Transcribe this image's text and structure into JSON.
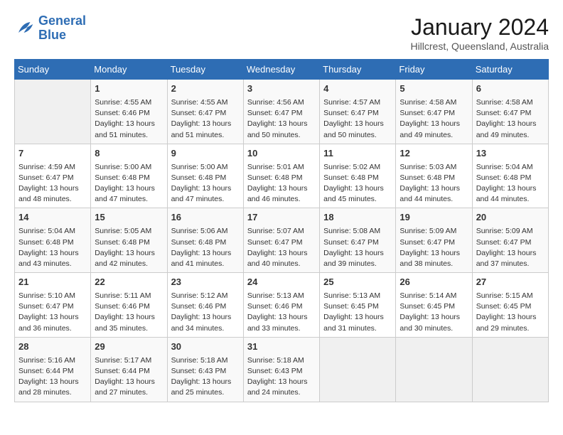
{
  "logo": {
    "line1": "General",
    "line2": "Blue"
  },
  "title": "January 2024",
  "subtitle": "Hillcrest, Queensland, Australia",
  "days_of_week": [
    "Sunday",
    "Monday",
    "Tuesday",
    "Wednesday",
    "Thursday",
    "Friday",
    "Saturday"
  ],
  "weeks": [
    [
      {
        "day": "",
        "content": ""
      },
      {
        "day": "1",
        "content": "Sunrise: 4:55 AM\nSunset: 6:46 PM\nDaylight: 13 hours\nand 51 minutes."
      },
      {
        "day": "2",
        "content": "Sunrise: 4:55 AM\nSunset: 6:47 PM\nDaylight: 13 hours\nand 51 minutes."
      },
      {
        "day": "3",
        "content": "Sunrise: 4:56 AM\nSunset: 6:47 PM\nDaylight: 13 hours\nand 50 minutes."
      },
      {
        "day": "4",
        "content": "Sunrise: 4:57 AM\nSunset: 6:47 PM\nDaylight: 13 hours\nand 50 minutes."
      },
      {
        "day": "5",
        "content": "Sunrise: 4:58 AM\nSunset: 6:47 PM\nDaylight: 13 hours\nand 49 minutes."
      },
      {
        "day": "6",
        "content": "Sunrise: 4:58 AM\nSunset: 6:47 PM\nDaylight: 13 hours\nand 49 minutes."
      }
    ],
    [
      {
        "day": "7",
        "content": "Sunrise: 4:59 AM\nSunset: 6:47 PM\nDaylight: 13 hours\nand 48 minutes."
      },
      {
        "day": "8",
        "content": "Sunrise: 5:00 AM\nSunset: 6:48 PM\nDaylight: 13 hours\nand 47 minutes."
      },
      {
        "day": "9",
        "content": "Sunrise: 5:00 AM\nSunset: 6:48 PM\nDaylight: 13 hours\nand 47 minutes."
      },
      {
        "day": "10",
        "content": "Sunrise: 5:01 AM\nSunset: 6:48 PM\nDaylight: 13 hours\nand 46 minutes."
      },
      {
        "day": "11",
        "content": "Sunrise: 5:02 AM\nSunset: 6:48 PM\nDaylight: 13 hours\nand 45 minutes."
      },
      {
        "day": "12",
        "content": "Sunrise: 5:03 AM\nSunset: 6:48 PM\nDaylight: 13 hours\nand 44 minutes."
      },
      {
        "day": "13",
        "content": "Sunrise: 5:04 AM\nSunset: 6:48 PM\nDaylight: 13 hours\nand 44 minutes."
      }
    ],
    [
      {
        "day": "14",
        "content": "Sunrise: 5:04 AM\nSunset: 6:48 PM\nDaylight: 13 hours\nand 43 minutes."
      },
      {
        "day": "15",
        "content": "Sunrise: 5:05 AM\nSunset: 6:48 PM\nDaylight: 13 hours\nand 42 minutes."
      },
      {
        "day": "16",
        "content": "Sunrise: 5:06 AM\nSunset: 6:48 PM\nDaylight: 13 hours\nand 41 minutes."
      },
      {
        "day": "17",
        "content": "Sunrise: 5:07 AM\nSunset: 6:47 PM\nDaylight: 13 hours\nand 40 minutes."
      },
      {
        "day": "18",
        "content": "Sunrise: 5:08 AM\nSunset: 6:47 PM\nDaylight: 13 hours\nand 39 minutes."
      },
      {
        "day": "19",
        "content": "Sunrise: 5:09 AM\nSunset: 6:47 PM\nDaylight: 13 hours\nand 38 minutes."
      },
      {
        "day": "20",
        "content": "Sunrise: 5:09 AM\nSunset: 6:47 PM\nDaylight: 13 hours\nand 37 minutes."
      }
    ],
    [
      {
        "day": "21",
        "content": "Sunrise: 5:10 AM\nSunset: 6:47 PM\nDaylight: 13 hours\nand 36 minutes."
      },
      {
        "day": "22",
        "content": "Sunrise: 5:11 AM\nSunset: 6:46 PM\nDaylight: 13 hours\nand 35 minutes."
      },
      {
        "day": "23",
        "content": "Sunrise: 5:12 AM\nSunset: 6:46 PM\nDaylight: 13 hours\nand 34 minutes."
      },
      {
        "day": "24",
        "content": "Sunrise: 5:13 AM\nSunset: 6:46 PM\nDaylight: 13 hours\nand 33 minutes."
      },
      {
        "day": "25",
        "content": "Sunrise: 5:13 AM\nSunset: 6:45 PM\nDaylight: 13 hours\nand 31 minutes."
      },
      {
        "day": "26",
        "content": "Sunrise: 5:14 AM\nSunset: 6:45 PM\nDaylight: 13 hours\nand 30 minutes."
      },
      {
        "day": "27",
        "content": "Sunrise: 5:15 AM\nSunset: 6:45 PM\nDaylight: 13 hours\nand 29 minutes."
      }
    ],
    [
      {
        "day": "28",
        "content": "Sunrise: 5:16 AM\nSunset: 6:44 PM\nDaylight: 13 hours\nand 28 minutes."
      },
      {
        "day": "29",
        "content": "Sunrise: 5:17 AM\nSunset: 6:44 PM\nDaylight: 13 hours\nand 27 minutes."
      },
      {
        "day": "30",
        "content": "Sunrise: 5:18 AM\nSunset: 6:43 PM\nDaylight: 13 hours\nand 25 minutes."
      },
      {
        "day": "31",
        "content": "Sunrise: 5:18 AM\nSunset: 6:43 PM\nDaylight: 13 hours\nand 24 minutes."
      },
      {
        "day": "",
        "content": ""
      },
      {
        "day": "",
        "content": ""
      },
      {
        "day": "",
        "content": ""
      }
    ]
  ]
}
